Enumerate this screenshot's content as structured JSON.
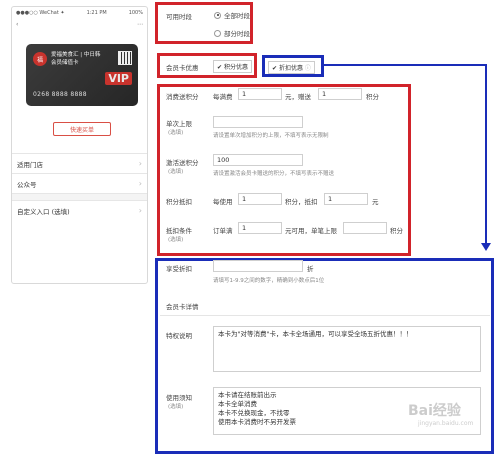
{
  "phone": {
    "status_left": "●●●○○ WeChat ✦",
    "status_time": "1:21 PM",
    "status_right": "100%",
    "title_left": "‹",
    "title_right": "⋯",
    "card": {
      "logo": "福",
      "name_line1": "爱福美食汇 | 中日韩",
      "name_line2": "会员储值卡",
      "vip": "VIP",
      "number": "0268 8888 8888"
    },
    "quick_buy_label": "快速买单",
    "list": [
      {
        "label": "适用门店"
      },
      {
        "label": "公众号"
      },
      {
        "label": "自定义入口 (选填)"
      }
    ]
  },
  "form": {
    "usable_time_label": "可用时段",
    "option_all_time": "全部时段",
    "option_partial_time": "部分时段",
    "member_discount_label": "会员卡优惠",
    "points_discount_label": "积分优惠",
    "discount_label": "折扣优惠",
    "consume_points": {
      "label": "消费送积分",
      "prefix": "每满费",
      "value1": "1",
      "middle": "元，赠送",
      "value2": "1",
      "suffix": "积分"
    },
    "single_limit": {
      "label": "单次上限",
      "sublabel": "(选填)",
      "value": "",
      "hint": "请设置单次增加积分的上限，不填写表示无限制"
    },
    "activate_points": {
      "label": "激活送积分",
      "sublabel": "(选填)",
      "value": "100",
      "hint": "请设置激活会员卡赠送的积分，不填写表示不赠送"
    },
    "points_deduct": {
      "label": "积分抵扣",
      "prefix": "每使用",
      "value1": "1",
      "middle": "积分，抵扣",
      "value2": "1",
      "suffix": "元"
    },
    "deduct_condition": {
      "label": "抵扣条件",
      "sublabel": "(选填)",
      "prefix": "订单满",
      "value1": "1",
      "middle": "元可用，单笔上限",
      "value2": "",
      "suffix": "积分"
    },
    "enjoy_discount": {
      "label": "享受折扣",
      "value": "",
      "suffix": "折",
      "hint": "请填写1-9.9之间的数字，精确到小数点后1位"
    },
    "card_detail_label": "会员卡详情",
    "privilege": {
      "label": "特权说明",
      "value": "本卡为\"对等消费\"卡，本卡全场通用，可以享受全场五折优惠！！！"
    },
    "usage_notes": {
      "label": "使用须知",
      "sublabel": "(选填)",
      "value": "本卡请在结账前出示\n本卡全单消费\n本卡不兑换现金，不找零\n使用本卡消费时不另开发票"
    }
  },
  "watermark": "Bai经验",
  "watermark_sub": "jingyan.baidu.com",
  "colors": {
    "red_box": "#d1232a",
    "blue_box": "#1a2db8"
  }
}
